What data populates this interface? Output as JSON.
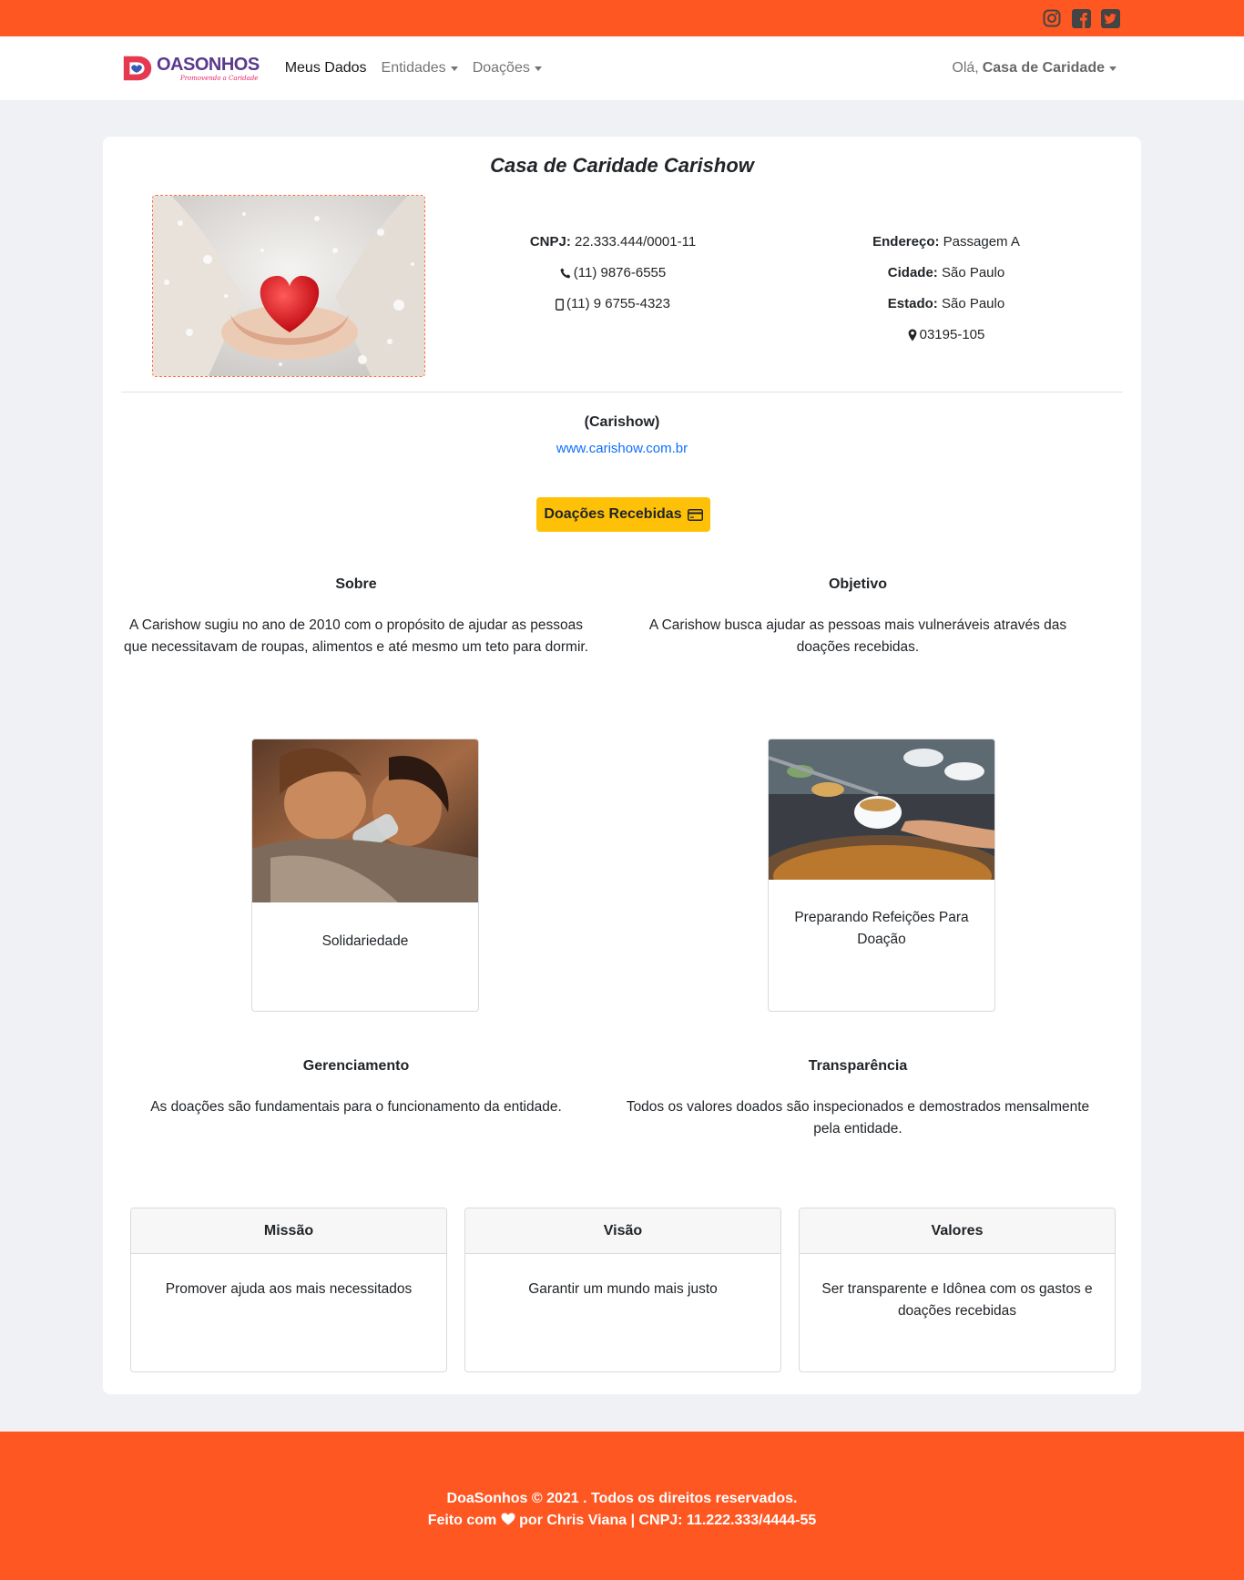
{
  "header": {
    "social": [
      "instagram-icon",
      "facebook-icon",
      "twitter-icon"
    ],
    "accent": "#ff5722"
  },
  "navbar": {
    "brand_name": "OASONHOS",
    "brand_tagline": "Promovendo a Caridade",
    "links": {
      "meus_dados": "Meus Dados",
      "entidades": "Entidades",
      "doacoes": "Doações"
    },
    "greeting": "Olá,",
    "user": "Casa de Caridade"
  },
  "entity": {
    "name": "Casa de Caridade Carishow",
    "cnpj_label": "CNPJ:",
    "cnpj": "22.333.444/0001-11",
    "phone": "(11) 9876-6555",
    "mobile": "(11) 9 6755-4323",
    "address_label": "Endereço:",
    "address": "Passagem A",
    "city_label": "Cidade:",
    "city": "São Paulo",
    "state_label": "Estado:",
    "state": "São Paulo",
    "cep": "03195-105",
    "short_name": "(Carishow)",
    "website": "www.carishow.com.br",
    "donations_button": "Doações Recebidas"
  },
  "sections": {
    "sobre": {
      "title": "Sobre",
      "text": "A Carishow sugiu no ano de 2010 com o propósito de ajudar as pessoas que necessitavam de roupas, alimentos e até mesmo um teto para dormir."
    },
    "objetivo": {
      "title": "Objetivo",
      "text": "A Carishow busca ajudar as pessoas mais vulneráveis através das doações recebidas."
    },
    "gerenciamento": {
      "title": "Gerenciamento",
      "text": "As doações são fundamentais para o funcionamento da entidade."
    },
    "transparencia": {
      "title": "Transparência",
      "text": "Todos os valores doados são inspecionados e demostrados mensalmente pela entidade."
    }
  },
  "photos": {
    "left_caption": "Solidariedade",
    "right_caption": "Preparando Refeições Para Doação"
  },
  "mvv": {
    "missao": {
      "title": "Missão",
      "text": "Promover ajuda aos mais necessitados"
    },
    "visao": {
      "title": "Visão",
      "text": "Garantir um mundo mais justo"
    },
    "valores": {
      "title": "Valores",
      "text": "Ser transparente e Idônea com os gastos e doações recebidas"
    }
  },
  "footer": {
    "line1": "DoaSonhos © 2021 . Todos os direitos reservados.",
    "line2_pre": "Feito com",
    "line2_post": "por Chris Viana | CNPJ: 11.222.333/4444-55"
  }
}
